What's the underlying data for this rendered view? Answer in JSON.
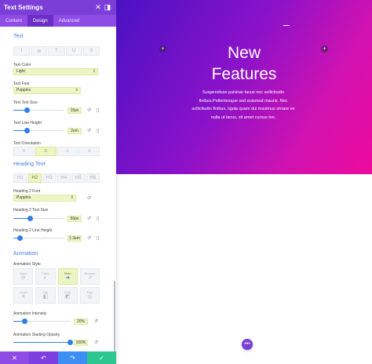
{
  "panel": {
    "title": "Text Settings",
    "tabs": [
      "Content",
      "Design",
      "Advanced"
    ],
    "active_tab": "Design"
  },
  "text_section": {
    "heading": "Text",
    "text_color_label": "Text Color",
    "text_color_value": "Light",
    "text_font_label": "Text Font",
    "text_font_value": "Poppins",
    "text_size_label": "Text Text Size",
    "text_size_value": "15px",
    "text_size_fraction": 0.27,
    "line_height_label": "Text Line Height",
    "line_height_value": "2em",
    "line_height_fraction": 0.27,
    "orientation_label": "Text Orientation"
  },
  "heading_section": {
    "heading": "Heading Text",
    "levels": [
      "H1",
      "H2",
      "H3",
      "H4",
      "H5",
      "H6"
    ],
    "selected_level": "H2",
    "font_label": "Heading 2 Font",
    "font_value": "Poppins",
    "size_label": "Heading 2 Text Size",
    "size_value": "50px",
    "size_fraction": 0.33,
    "line_height_label": "Heading 2 Line Height",
    "line_height_value": "1.3em",
    "line_height_fraction": 0.13
  },
  "animation_section": {
    "heading": "Animation",
    "style_label": "Animation Style",
    "styles": [
      {
        "name": "None",
        "icon": "none-icon",
        "glyph": "⊘"
      },
      {
        "name": "Fade",
        "icon": "fade-icon",
        "glyph": "◐"
      },
      {
        "name": "Slide",
        "icon": "slide-icon",
        "glyph": "➜"
      },
      {
        "name": "Bounce",
        "icon": "bounce-icon",
        "glyph": "↗"
      },
      {
        "name": "Zoom",
        "icon": "zoom-icon",
        "glyph": "✕"
      },
      {
        "name": "Flip",
        "icon": "flip-icon",
        "glyph": "◧"
      },
      {
        "name": "Fold",
        "icon": "fold-icon",
        "glyph": "◩"
      },
      {
        "name": "Roll",
        "icon": "roll-icon",
        "glyph": "◎"
      }
    ],
    "selected_style": "Slide",
    "intensity_label": "Animation Intensity",
    "intensity_value": "20%",
    "intensity_fraction": 0.2,
    "opacity_label": "Animation Starting Opacity",
    "opacity_value": "100%",
    "opacity_fraction": 1.0
  },
  "preview": {
    "title_line1": "New",
    "title_line2": "Features",
    "body": "Suspendisse pulvinar lacus nec sollicitudin finibus.Pellentesque sed euismod mauris. Nec sollicitudin finibus, ligula quam dui maximus ornare ex nulla ut lacus, sit amet cursus leo."
  },
  "colors": {
    "accent_purple": "#7b3fd8",
    "slider_blue": "#2e7fe6",
    "section_blue": "#4c7fd6",
    "selected_fill": "#eef5c4",
    "footer_cancel": "#8e4be6",
    "footer_undo": "#7d3fe0",
    "footer_redo": "#3d8ef5",
    "footer_save": "#2cc68f"
  },
  "icons": {
    "close": "close-icon",
    "expand": "expand-icon",
    "reset": "reset-icon",
    "device": "device-icon",
    "add": "plus-icon",
    "more": "more-icon"
  }
}
